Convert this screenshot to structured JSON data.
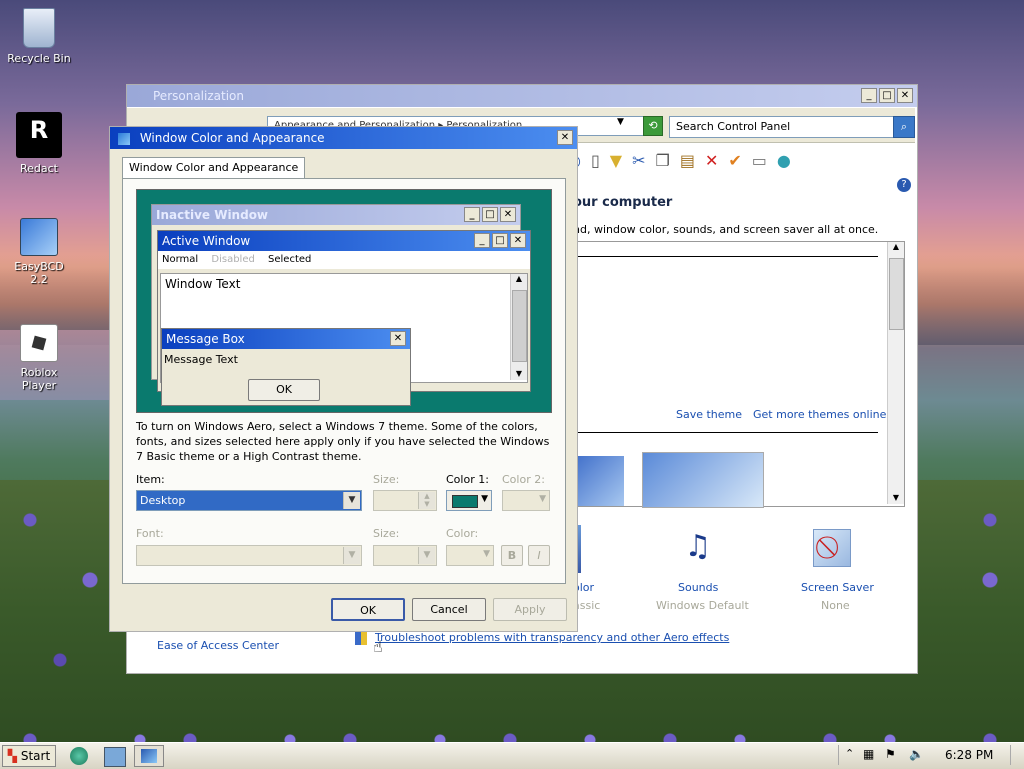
{
  "desktop": {
    "icons": [
      {
        "label": "Recycle Bin"
      },
      {
        "label": "Redact"
      },
      {
        "label": "EasyBCD 2.2"
      },
      {
        "label": "Roblox Player"
      }
    ]
  },
  "personalization": {
    "title": "Personalization",
    "breadcrumb": "Appearance and Personalization  ▸  Personalization",
    "search_placeholder": "Search Control Panel",
    "heading": "our computer",
    "subtext": "nd, window color, sounds, and screen saver all at once.",
    "save_theme": "Save theme",
    "get_more_themes": "Get more themes online",
    "color_label": "olor",
    "color_value": "assic",
    "sounds_label": "Sounds",
    "sounds_value": "Windows Default",
    "screensaver_label": "Screen Saver",
    "screensaver_value": "None",
    "ease_of_access": "Ease of Access Center",
    "troubleshoot": "Troubleshoot problems with transparency and other Aero effects"
  },
  "dialog": {
    "title": "Window Color and Appearance",
    "tab": "Window Color and Appearance",
    "preview": {
      "inactive_title": "Inactive Window",
      "active_title": "Active Window",
      "menu_normal": "Normal",
      "menu_disabled": "Disabled",
      "menu_selected": "Selected",
      "window_text": "Window Text",
      "msgbox_title": "Message Box",
      "msgbox_text": "Message Text",
      "msgbox_ok": "OK"
    },
    "description": "To turn on Windows Aero, select a Windows 7 theme.  Some of the colors, fonts, and sizes selected here apply only if you have selected the Windows 7 Basic theme or a High Contrast theme.",
    "item_label": "Item:",
    "item_value": "Desktop",
    "size_label": "Size:",
    "color1_label": "Color 1:",
    "color2_label": "Color 2:",
    "font_label": "Font:",
    "size2_label": "Size:",
    "color_label": "Color:",
    "bold": "B",
    "italic": "I",
    "ok": "OK",
    "cancel": "Cancel",
    "apply": "Apply",
    "desktop_color": "#0a7a6e"
  },
  "taskbar": {
    "start": "Start",
    "clock": "6:28 PM"
  }
}
